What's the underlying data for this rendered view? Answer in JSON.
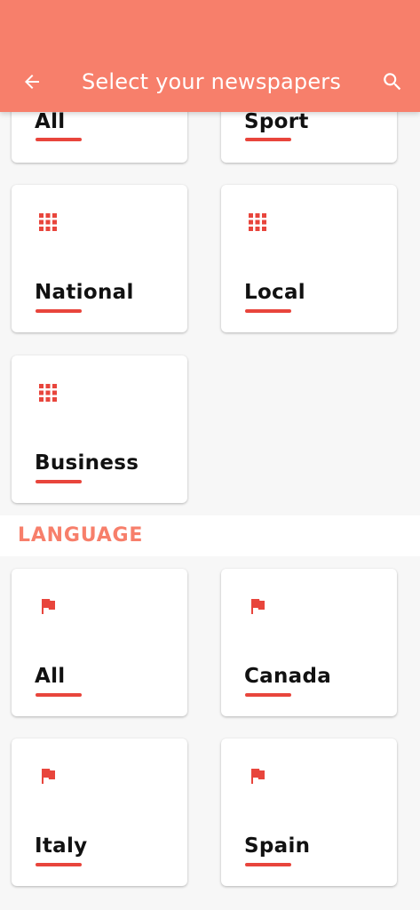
{
  "header": {
    "title": "Select your newspapers",
    "back_icon": "arrow-left-icon",
    "search_icon": "search-icon",
    "color": "#f77f6b"
  },
  "categories": [
    {
      "label": "All",
      "icon": "grid-icon"
    },
    {
      "label": "Sport",
      "icon": "grid-icon"
    },
    {
      "label": "National",
      "icon": "grid-icon"
    },
    {
      "label": "Local",
      "icon": "grid-icon"
    },
    {
      "label": "Business",
      "icon": "grid-icon"
    }
  ],
  "language_section": {
    "title": "LANGUAGE",
    "items": [
      {
        "label": "All",
        "icon": "flag-icon"
      },
      {
        "label": "Canada",
        "icon": "flag-icon"
      },
      {
        "label": "Italy",
        "icon": "flag-icon"
      },
      {
        "label": "Spain",
        "icon": "flag-icon"
      }
    ]
  },
  "accent_color": "#e8453c"
}
